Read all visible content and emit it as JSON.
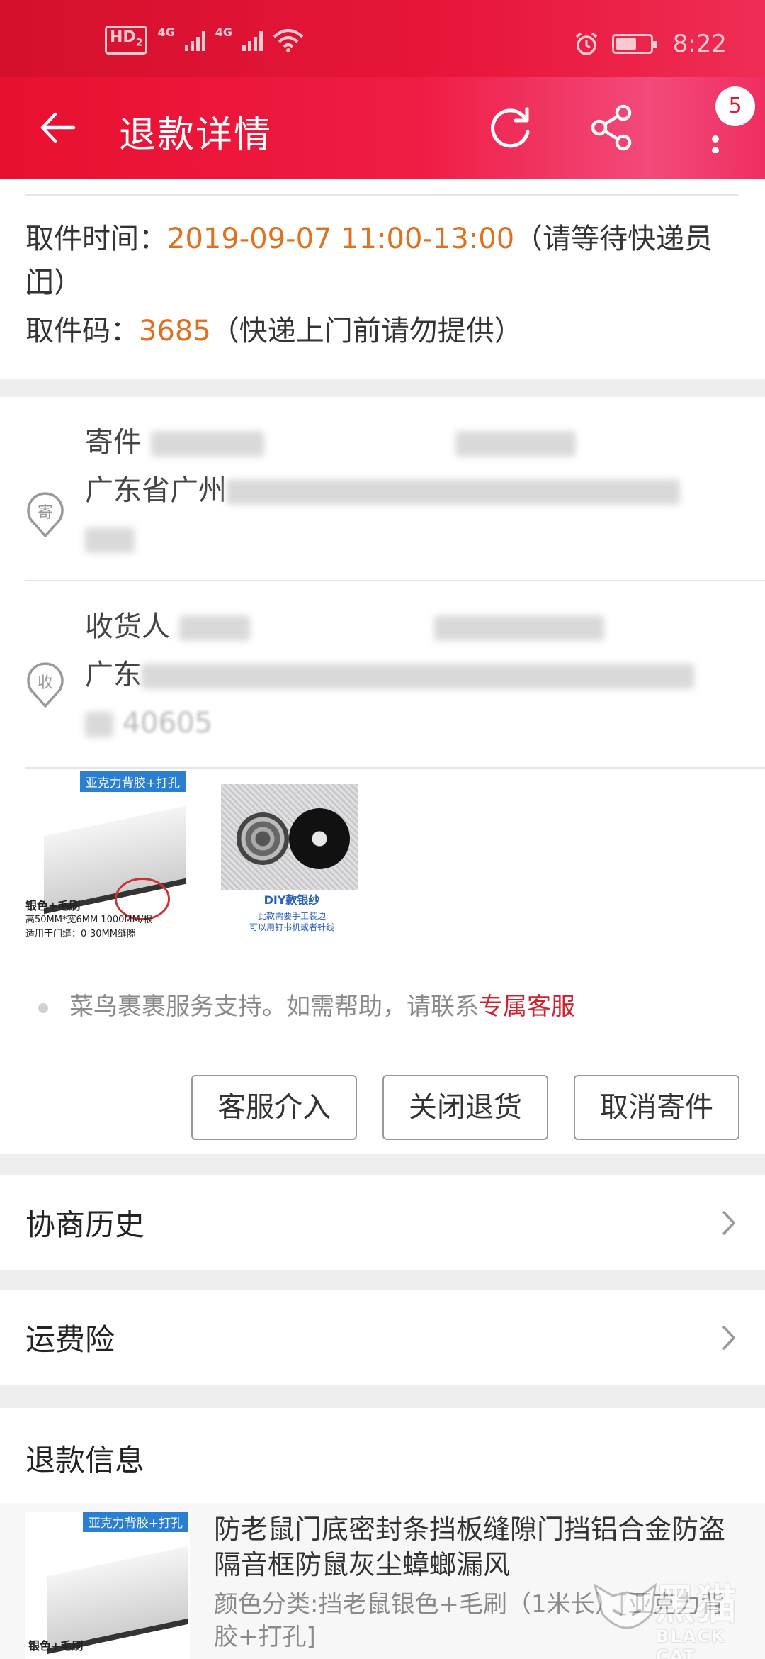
{
  "status_bar": {
    "hd_label": "HD",
    "hd_sub": "2",
    "network1": "4G",
    "network2": "4G",
    "time": "8:22"
  },
  "app_bar": {
    "title": "退款详情",
    "notification_count": "5"
  },
  "pickup": {
    "time_label": "取件时间：",
    "time_value": "2019-09-07 11:00-13:00",
    "time_note_1": "（请等待快递员上",
    "time_note_2": "门）",
    "code_label": "取件码：",
    "code_value": "3685",
    "code_note": "（快递上门前请勿提供）"
  },
  "sender": {
    "icon_char": "寄",
    "label": "寄件",
    "province": "广东省广州"
  },
  "receiver": {
    "icon_char": "收",
    "label": "收货人",
    "province": "广东",
    "zip_partial": "40605"
  },
  "goods": [
    {
      "tag": "亚克力背胶+打孔",
      "line1": "银色+毛刷",
      "line2": "高50MM*宽6MM 1000MM/根",
      "line3": "适用于门缝：0-30MM缝隙"
    },
    {
      "caption1": "DIY款银纱",
      "caption2": "此款需要手工装边",
      "caption3": "可以用钉书机或者针线"
    }
  ],
  "support": {
    "text": "菜鸟裹裹服务支持。如需帮助，请联系",
    "link": "专属客服"
  },
  "buttons": {
    "service": "客服介入",
    "close_return": "关闭退货",
    "cancel_send": "取消寄件"
  },
  "negotiation_history": {
    "label": "协商历史"
  },
  "shipping_insurance": {
    "label": "运费险"
  },
  "refund_info": {
    "label": "退款信息",
    "product_title": "防老鼠门底密封条挡板缝隙门挡铝合金防盗隔音框防鼠灰尘蟑螂漏风",
    "product_spec": "颜色分类:挡老鼠银色+毛刷（1米长）[亚克力背胶+打孔]",
    "thumb_tag": "亚克力背胶+打孔",
    "thumb_line": "银色+毛刷"
  },
  "watermark": {
    "cn": "黑猫",
    "en": "BLACK CAT"
  },
  "colors": {
    "brand_red": "#e7102f",
    "accent_orange": "#e0701e",
    "link_red": "#d0202e"
  }
}
